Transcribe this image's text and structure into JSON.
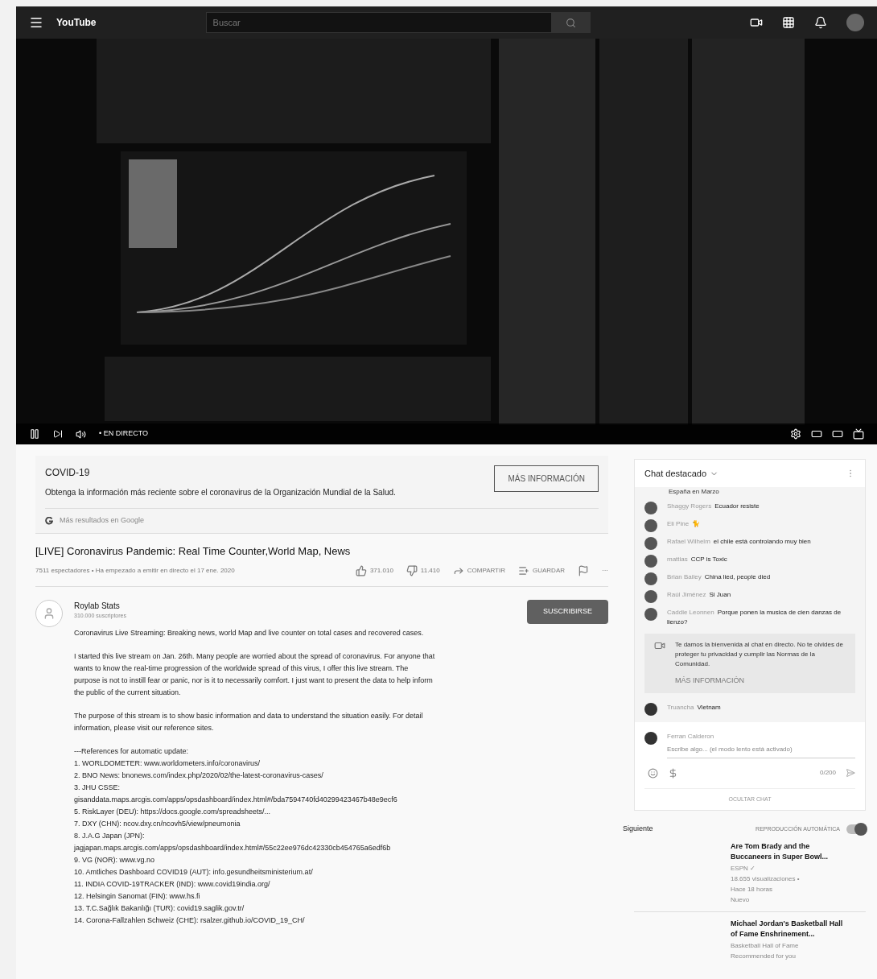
{
  "topbar": {
    "logo": "YouTube",
    "search": {
      "placeholder": "Buscar"
    }
  },
  "player": {
    "live_label": "• EN DIRECTO",
    "playing": true
  },
  "info_panel": {
    "title": "COVID-19",
    "text": "Obtenga la información más reciente sobre el coronavirus de la Organización Mundial de la Salud.",
    "button": "MÁS INFORMACIÓN",
    "footer": "Más resultados en Google"
  },
  "video": {
    "title": "[LIVE] Coronavirus Pandemic: Real Time Counter,World Map, News",
    "meta": "7511 espectadores • Ha empezado a emitir en directo el 17 ene. 2020",
    "actions": [
      {
        "kind": "like",
        "label": "371.010"
      },
      {
        "kind": "dislike",
        "label": "11.410"
      },
      {
        "kind": "share",
        "label": "COMPARTIR"
      },
      {
        "kind": "save",
        "label": "GUARDAR"
      },
      {
        "kind": "flag"
      },
      {
        "kind": "more",
        "label": "···"
      }
    ]
  },
  "channel": {
    "name": "Roylab Stats",
    "subscribers": "310.000 suscriptores",
    "subscribe": "SUSCRIBIRSE"
  },
  "description": {
    "paragraphs": [
      "Coronavirus Live Streaming: Breaking news, world Map and live counter on total cases and recovered cases.",
      "I started this live stream on Jan. 26th. Many people are worried about the spread of coronavirus. For anyone that wants to know the real-time progression of the worldwide spread of this virus, I offer this live stream. The purpose is not to instill fear or panic, nor is it to necessarily comfort. I just want to present the data to help inform the public of the current situation.",
      "The purpose of this stream is to show basic information and data to understand the situation easily. For detail information, please visit our reference sites."
    ],
    "references": [
      "---References for automatic update:",
      "1. WORLDOMETER: www.worldometers.info/coronavirus/",
      "2. BNO News: bnonews.com/index.php/2020/02/the-latest-coronavirus-cases/",
      "3. JHU CSSE:",
      "gisanddata.maps.arcgis.com/apps/opsdashboard/index.html#/bda7594740fd40299423467b48e9ecf6",
      "5. RiskLayer (DEU): https://docs.google.com/spreadsheets/...",
      "7. DXY (CHN): ncov.dxy.cn/ncovh5/view/pneumonia",
      "8. J.A.G Japan (JPN):",
      "jagjapan.maps.arcgis.com/apps/opsdashboard/index.html#/55c22ee976dc42330cb454765a6edf6b",
      "9. VG (NOR): www.vg.no",
      "10. Amtliches Dashboard COVID19 (AUT): info.gesundheitsministerium.at/",
      "11. INDIA COVID-19TRACKER (IND): www.covid19india.org/",
      "12. Helsingin Sanomat (FIN): www.hs.fi",
      "13. T.C.Sağlık Bakanlığı (TUR): covid19.saglik.gov.tr/",
      "14. Corona-Fallzahlen Schweiz (CHE): rsalzer.github.io/COVID_19_CH/"
    ]
  },
  "chat": {
    "title": "Chat destacado",
    "first_line": "España en Marzo",
    "messages": [
      {
        "author": "Shaggy Rogers",
        "text": "Ecuador resiste"
      },
      {
        "author": "Eli Pine",
        "text": "🐈"
      },
      {
        "author": "Rafael Wilhelm",
        "text": "el chile está controlando muy bien"
      },
      {
        "author": "mattias",
        "text": "CCP is Toxic"
      },
      {
        "author": "Brian Bailey",
        "text": "China lied, people died"
      },
      {
        "author": "Raúl Jiménez",
        "text": "Si Juan"
      },
      {
        "author": "Caddie Leonnen",
        "text": "Porque ponen la musica de cien danzas de lienzo?"
      }
    ],
    "notice": {
      "text": "Te damos la bienvenida al chat en directo. No te olvides de proteger tu privacidad y cumplir las Normas de la Comunidad.",
      "link": "MÁS INFORMACIÓN"
    },
    "last_message": {
      "author": "Truancha",
      "text": "Vietnam"
    },
    "composer": {
      "author": "Ferran Calderon",
      "placeholder": "Escribe algo... (el modo lento está activado)",
      "counter": "0/200"
    },
    "hide": "OCULTAR CHAT"
  },
  "upnext": {
    "title": "Siguiente",
    "autoplay_label": "REPRODUCCIÓN AUTOMÁTICA",
    "autoplay_on": true,
    "items": [
      {
        "title": "Are Tom Brady and the Buccaneers in Super Bowl...",
        "lines": [
          "ESPN ✓",
          "18.655 visualizaciones •",
          "Hace 18 horas",
          "Nuevo"
        ]
      },
      {
        "title": "Michael Jordan's Basketball Hall of Fame Enshrinement...",
        "lines": [
          "Basketball Hall of Fame",
          "Recommended for you"
        ]
      }
    ]
  }
}
